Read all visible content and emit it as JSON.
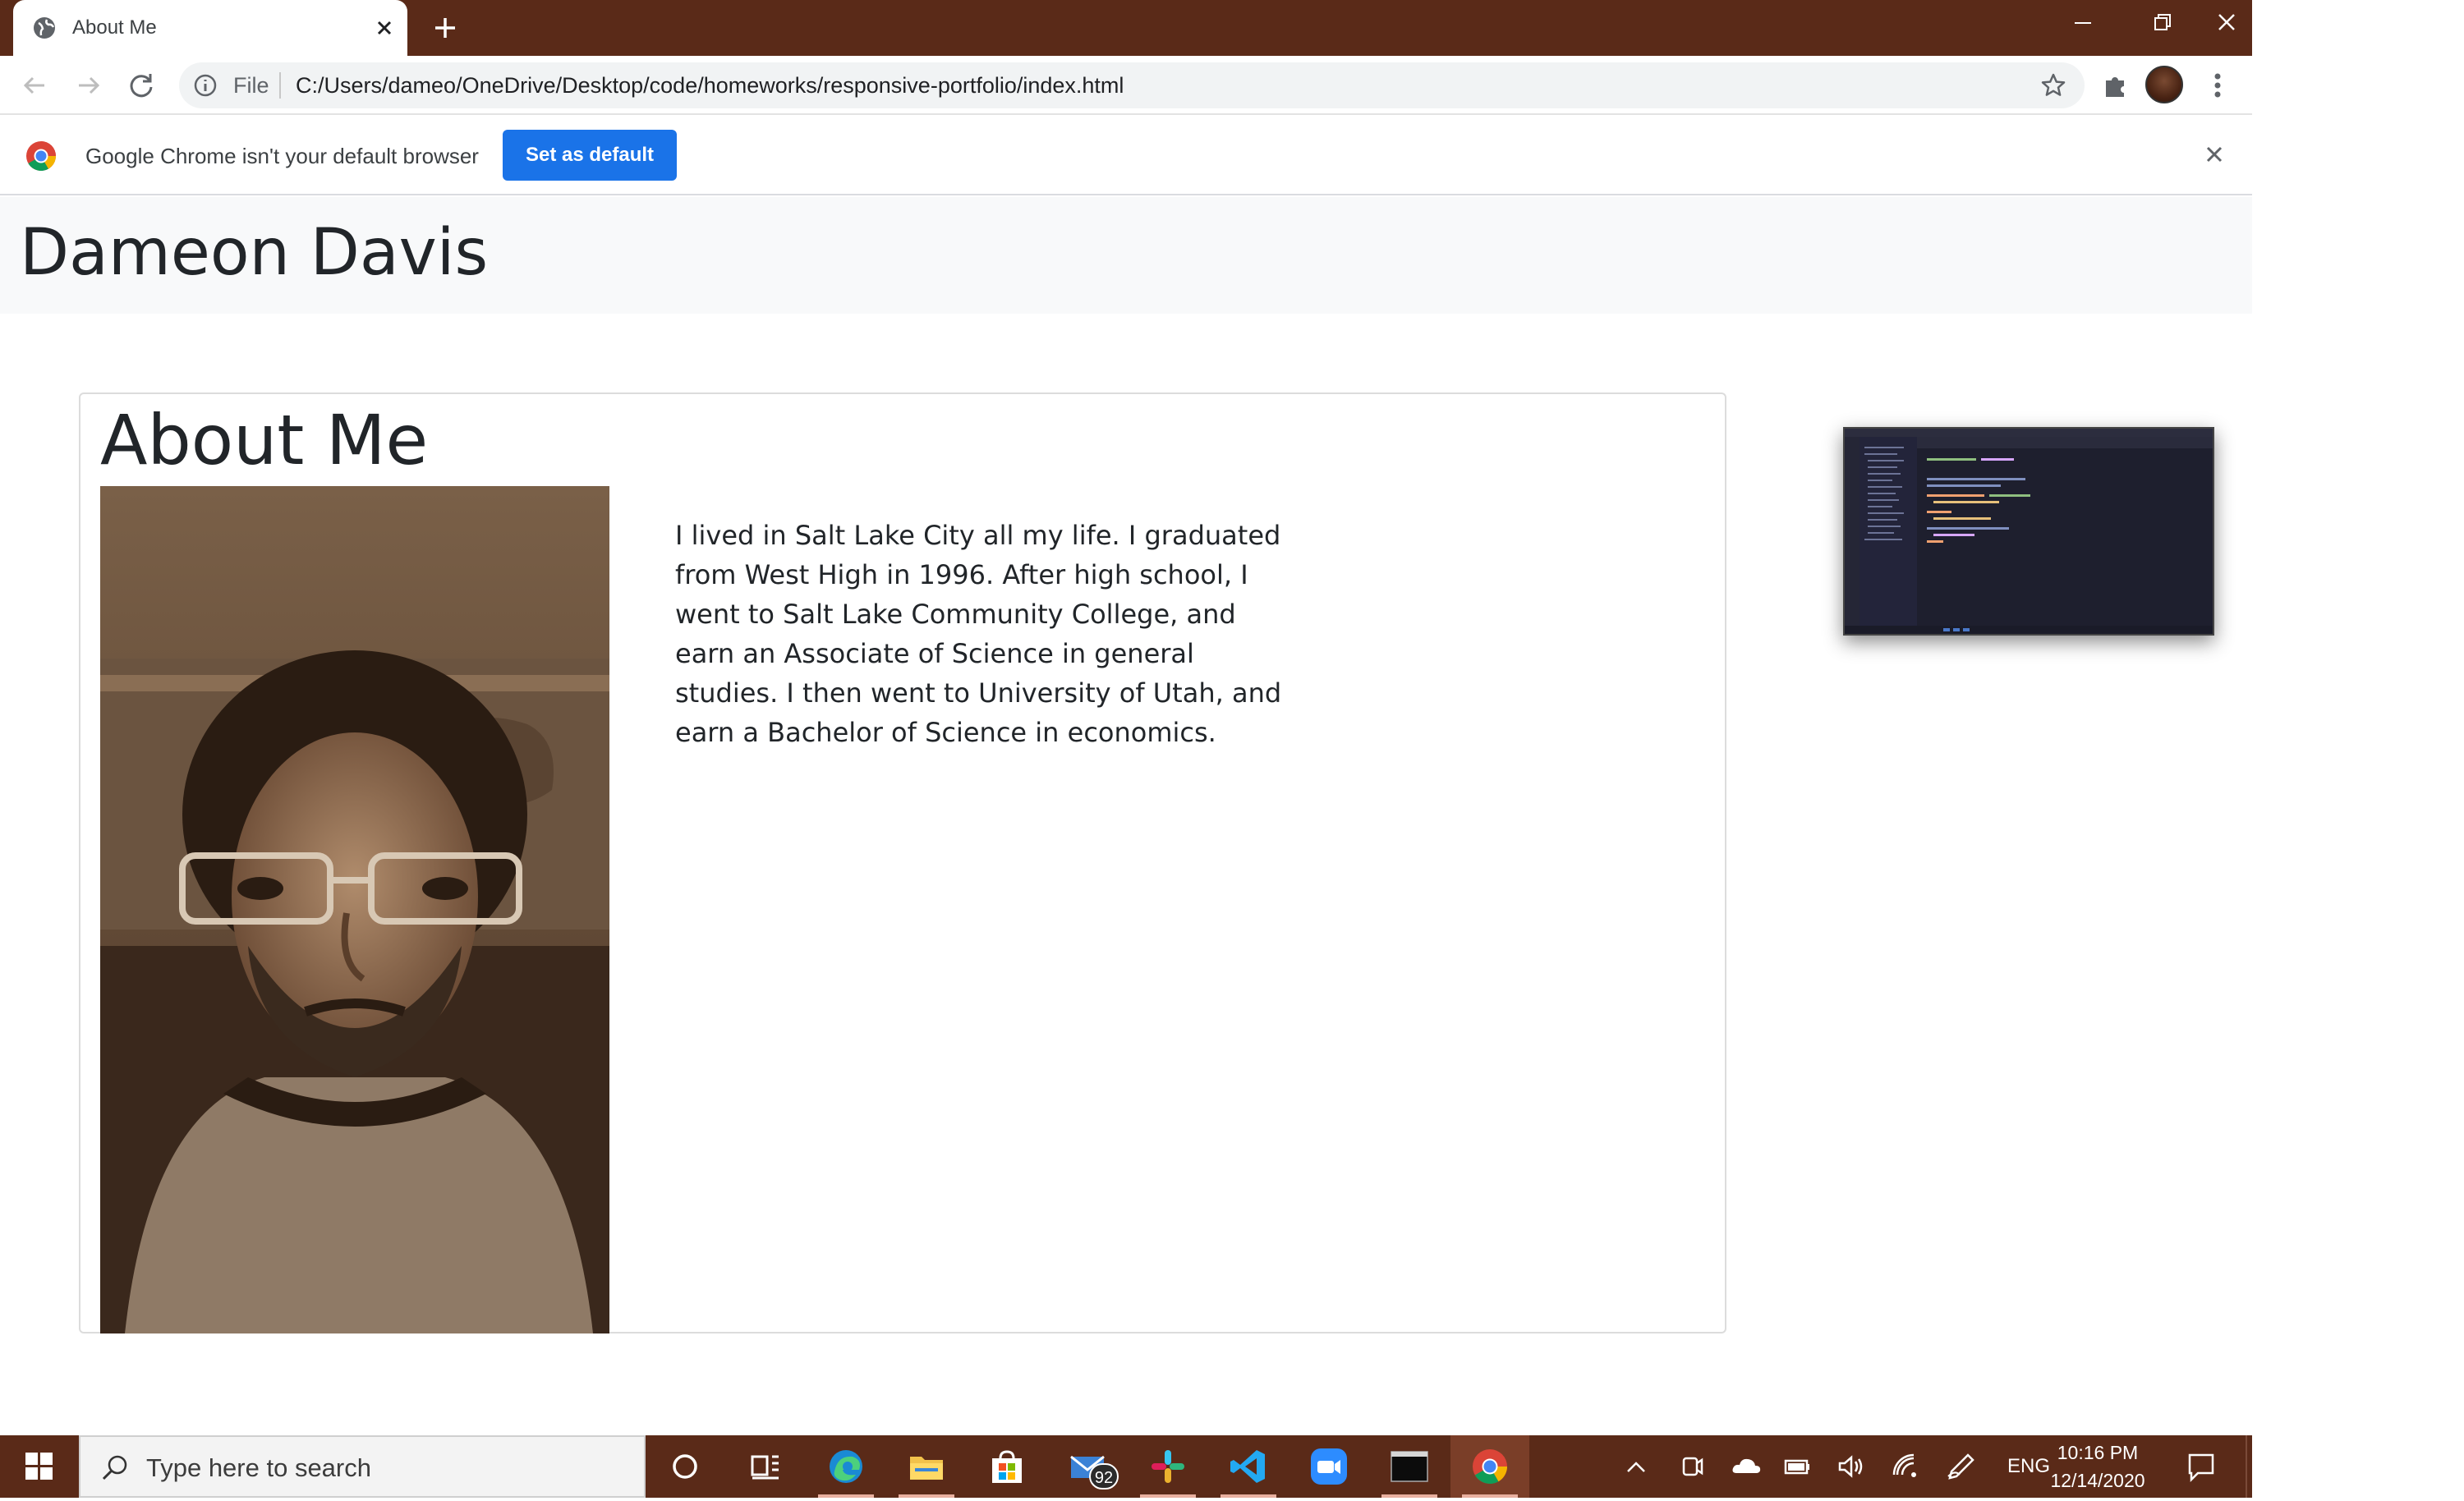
{
  "browser": {
    "tab_title": "About Me",
    "omnibox": {
      "scheme_label": "File",
      "url": "C:/Users/dameo/OneDrive/Desktop/code/homeworks/responsive-portfolio/index.html"
    },
    "infobar": {
      "message": "Google Chrome isn't your default browser",
      "button_label": "Set as default"
    }
  },
  "page": {
    "site_name": "Dameon Davis",
    "card_title": "About Me",
    "bio": "I lived in Salt Lake City all my life. I graduated from West High in 1996. After high school, I went to Salt Lake Community College, and earn an Associate of Science in general studies. I then went to University of Utah, and earn a Bachelor of Science in economics."
  },
  "taskbar": {
    "search_placeholder": "Type here to search",
    "mail_badge": "92",
    "language": "ENG",
    "time": "10:16 PM",
    "date": "12/14/2020"
  },
  "colors": {
    "titlebar": "#5a2a18",
    "accent_button": "#1a73e8",
    "page_header_bg": "#f8f9fa"
  }
}
